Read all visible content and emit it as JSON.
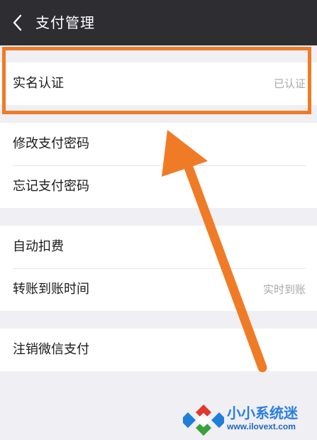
{
  "header": {
    "title": "支付管理"
  },
  "groups": [
    {
      "items": [
        {
          "label": "实名认证",
          "value": "已认证"
        }
      ]
    },
    {
      "items": [
        {
          "label": "修改支付密码"
        },
        {
          "label": "忘记支付密码"
        }
      ]
    },
    {
      "items": [
        {
          "label": "自动扣费"
        },
        {
          "label": "转账到账时间",
          "value": "实时到账"
        }
      ]
    },
    {
      "items": [
        {
          "label": "注销微信支付"
        }
      ]
    }
  ],
  "watermark": {
    "brand": "小小系统迷",
    "url": "www.ilovext.com"
  },
  "colors": {
    "header_bg": "#2e2e32",
    "highlight": "#f07b26",
    "page_bg": "#efeff4"
  },
  "icons": {
    "back": "chevron-left-icon"
  }
}
